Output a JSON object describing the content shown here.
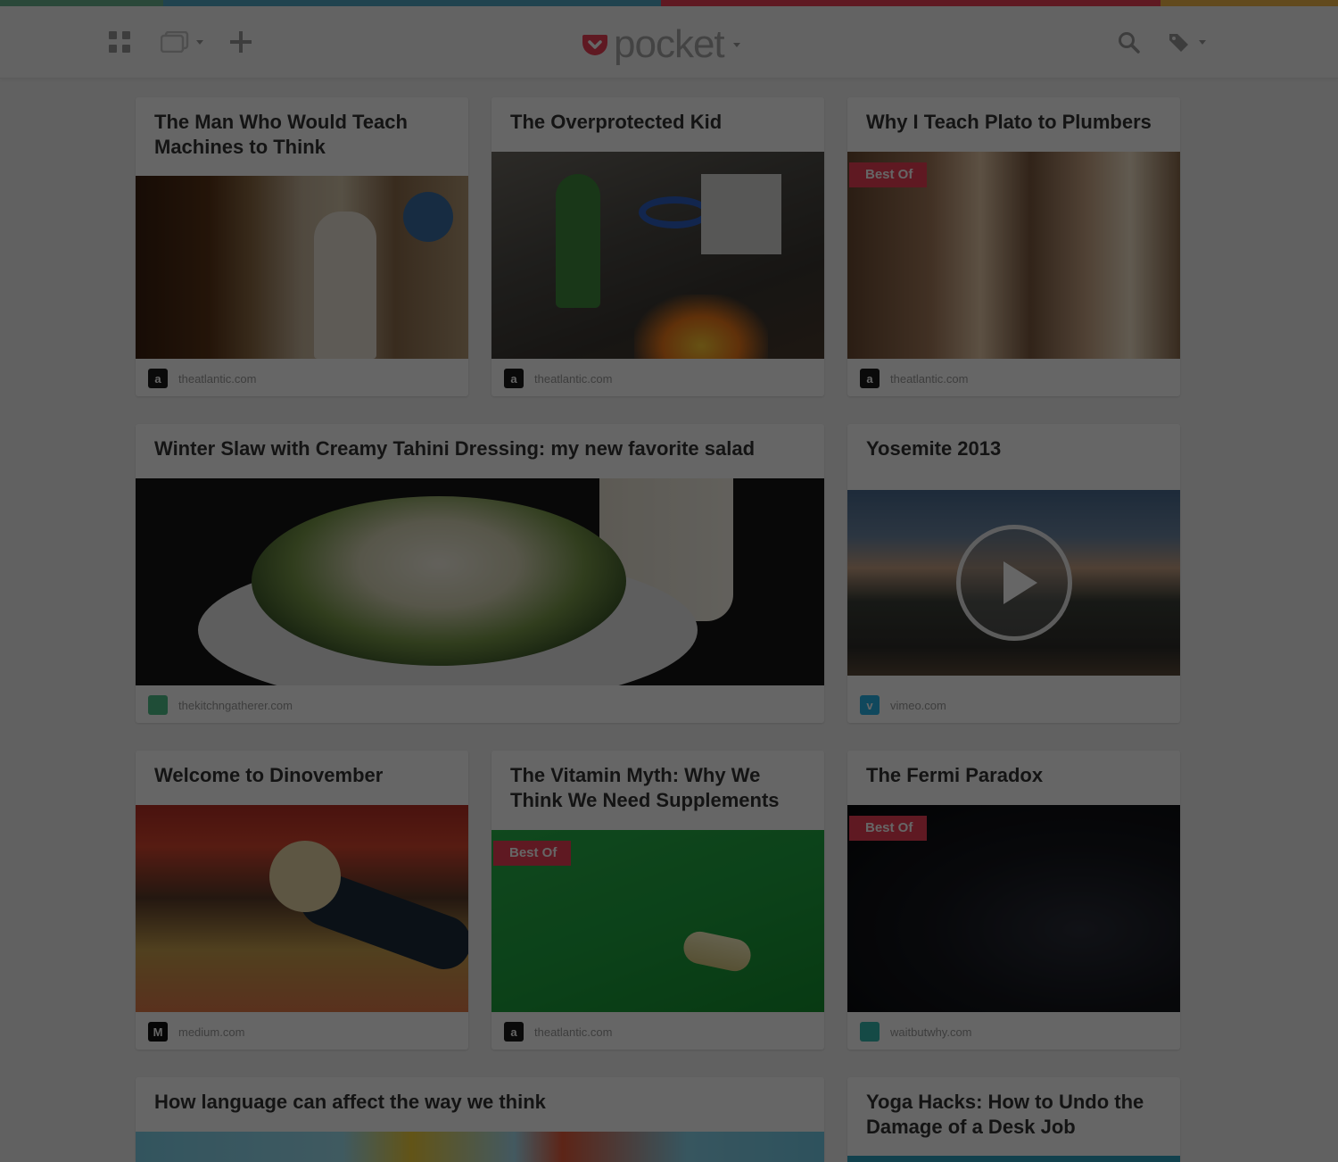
{
  "app": {
    "name": "pocket",
    "stripe_colors": [
      "#6ab48f",
      "#52a8c6",
      "#ee4056",
      "#f4b84a"
    ]
  },
  "toolbar": {
    "grid_icon": "grid-view-icon",
    "list_icon": "list-view-icon",
    "add_icon": "add-icon",
    "search_icon": "search-icon",
    "tag_icon": "tag-icon"
  },
  "items": [
    {
      "title": "The Man Who Would Teach Machines to Think",
      "domain": "theatlantic.com",
      "favicon": "a",
      "badge": ""
    },
    {
      "title": "The Overprotected Kid",
      "domain": "theatlantic.com",
      "favicon": "a",
      "badge": ""
    },
    {
      "title": "Why I Teach Plato to Plumbers",
      "domain": "theatlantic.com",
      "favicon": "a",
      "badge": "Best Of"
    },
    {
      "title": "Winter Slaw with Creamy Tahini Dressing: my new favorite salad",
      "domain": "thekitchngatherer.com",
      "favicon": "",
      "badge": ""
    },
    {
      "title": "Yosemite 2013",
      "domain": "vimeo.com",
      "favicon": "v",
      "badge": ""
    },
    {
      "title": "Welcome to Dinovember",
      "domain": "medium.com",
      "favicon": "M",
      "badge": ""
    },
    {
      "title": "The Vitamin Myth: Why We Think We Need Supplements",
      "domain": "theatlantic.com",
      "favicon": "a",
      "badge": "Best Of"
    },
    {
      "title": "The Fermi Paradox",
      "domain": "waitbutwhy.com",
      "favicon": "",
      "badge": "Best Of"
    },
    {
      "title": "How language can affect the way we think",
      "domain": "",
      "favicon": "",
      "badge": ""
    },
    {
      "title": "Yoga Hacks: How to Undo the Damage of a Desk Job",
      "domain": "",
      "favicon": "",
      "badge": ""
    }
  ]
}
